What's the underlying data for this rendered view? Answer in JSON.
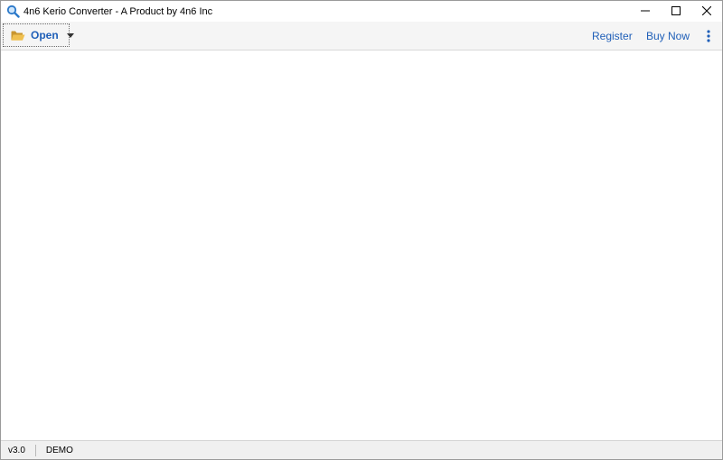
{
  "window": {
    "title": "4n6 Kerio Converter - A Product by 4n6 Inc",
    "app_icon": "magnifier-search-icon",
    "controls": {
      "minimize_icon": "minimize-icon",
      "maximize_icon": "maximize-icon",
      "close_icon": "close-icon"
    }
  },
  "toolbar": {
    "open_label": "Open",
    "open_icon": "folder-open-icon",
    "open_caret_icon": "caret-down-icon",
    "register_label": "Register",
    "buy_now_label": "Buy Now",
    "more_icon": "kebab-menu-icon"
  },
  "statusbar": {
    "version": "v3.0",
    "mode": "DEMO"
  },
  "colors": {
    "link_blue": "#1f5fb8",
    "toolbar_bg": "#f5f5f5",
    "folder_yellow": "#e8b84a",
    "statusbar_bg": "#f0f0f0"
  }
}
